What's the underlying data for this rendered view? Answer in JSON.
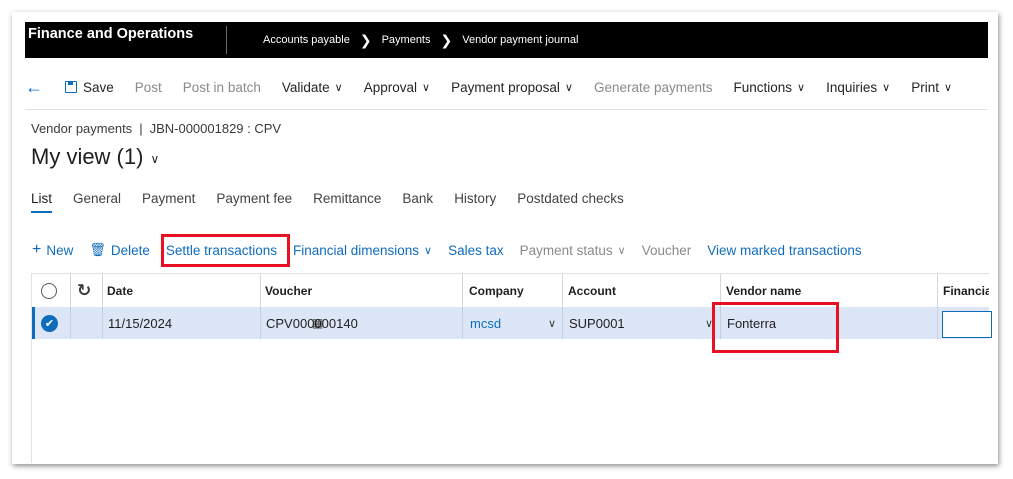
{
  "nav": {
    "app_title": "Finance and Operations",
    "breadcrumbs": [
      "Accounts payable",
      "Payments",
      "Vendor payment journal"
    ]
  },
  "actions": {
    "save": "Save",
    "post": "Post",
    "post_in_batch": "Post in batch",
    "validate": "Validate",
    "approval": "Approval",
    "payment_proposal": "Payment proposal",
    "generate_payments": "Generate payments",
    "functions": "Functions",
    "inquiries": "Inquiries",
    "print": "Print"
  },
  "page": {
    "breadcrumb_left": "Vendor payments",
    "breadcrumb_right": "JBN-000001829 : CPV",
    "view_title": "My view (1)"
  },
  "tabs": [
    "List",
    "General",
    "Payment",
    "Payment fee",
    "Remittance",
    "Bank",
    "History",
    "Postdated checks"
  ],
  "grid_actions": {
    "new": "New",
    "delete": "Delete",
    "settle_transactions": "Settle transactions",
    "financial_dimensions": "Financial dimensions",
    "sales_tax": "Sales tax",
    "payment_status": "Payment status",
    "voucher": "Voucher",
    "view_marked_transactions": "View marked transactions"
  },
  "grid": {
    "columns": {
      "date": "Date",
      "voucher": "Voucher",
      "company": "Company",
      "account": "Account",
      "vendor_name": "Vendor name",
      "financial": "Financial"
    },
    "rows": [
      {
        "date": "11/15/2024",
        "voucher": "CPV000000140",
        "company": "mcsd",
        "account": "SUP0001",
        "vendor_name": "Fonterra",
        "financial": ""
      }
    ]
  },
  "colors": {
    "accent": "#0f6cbd",
    "selected_row": "#dde6f7",
    "highlight": "#e81123",
    "nav_bg": "#000000"
  }
}
